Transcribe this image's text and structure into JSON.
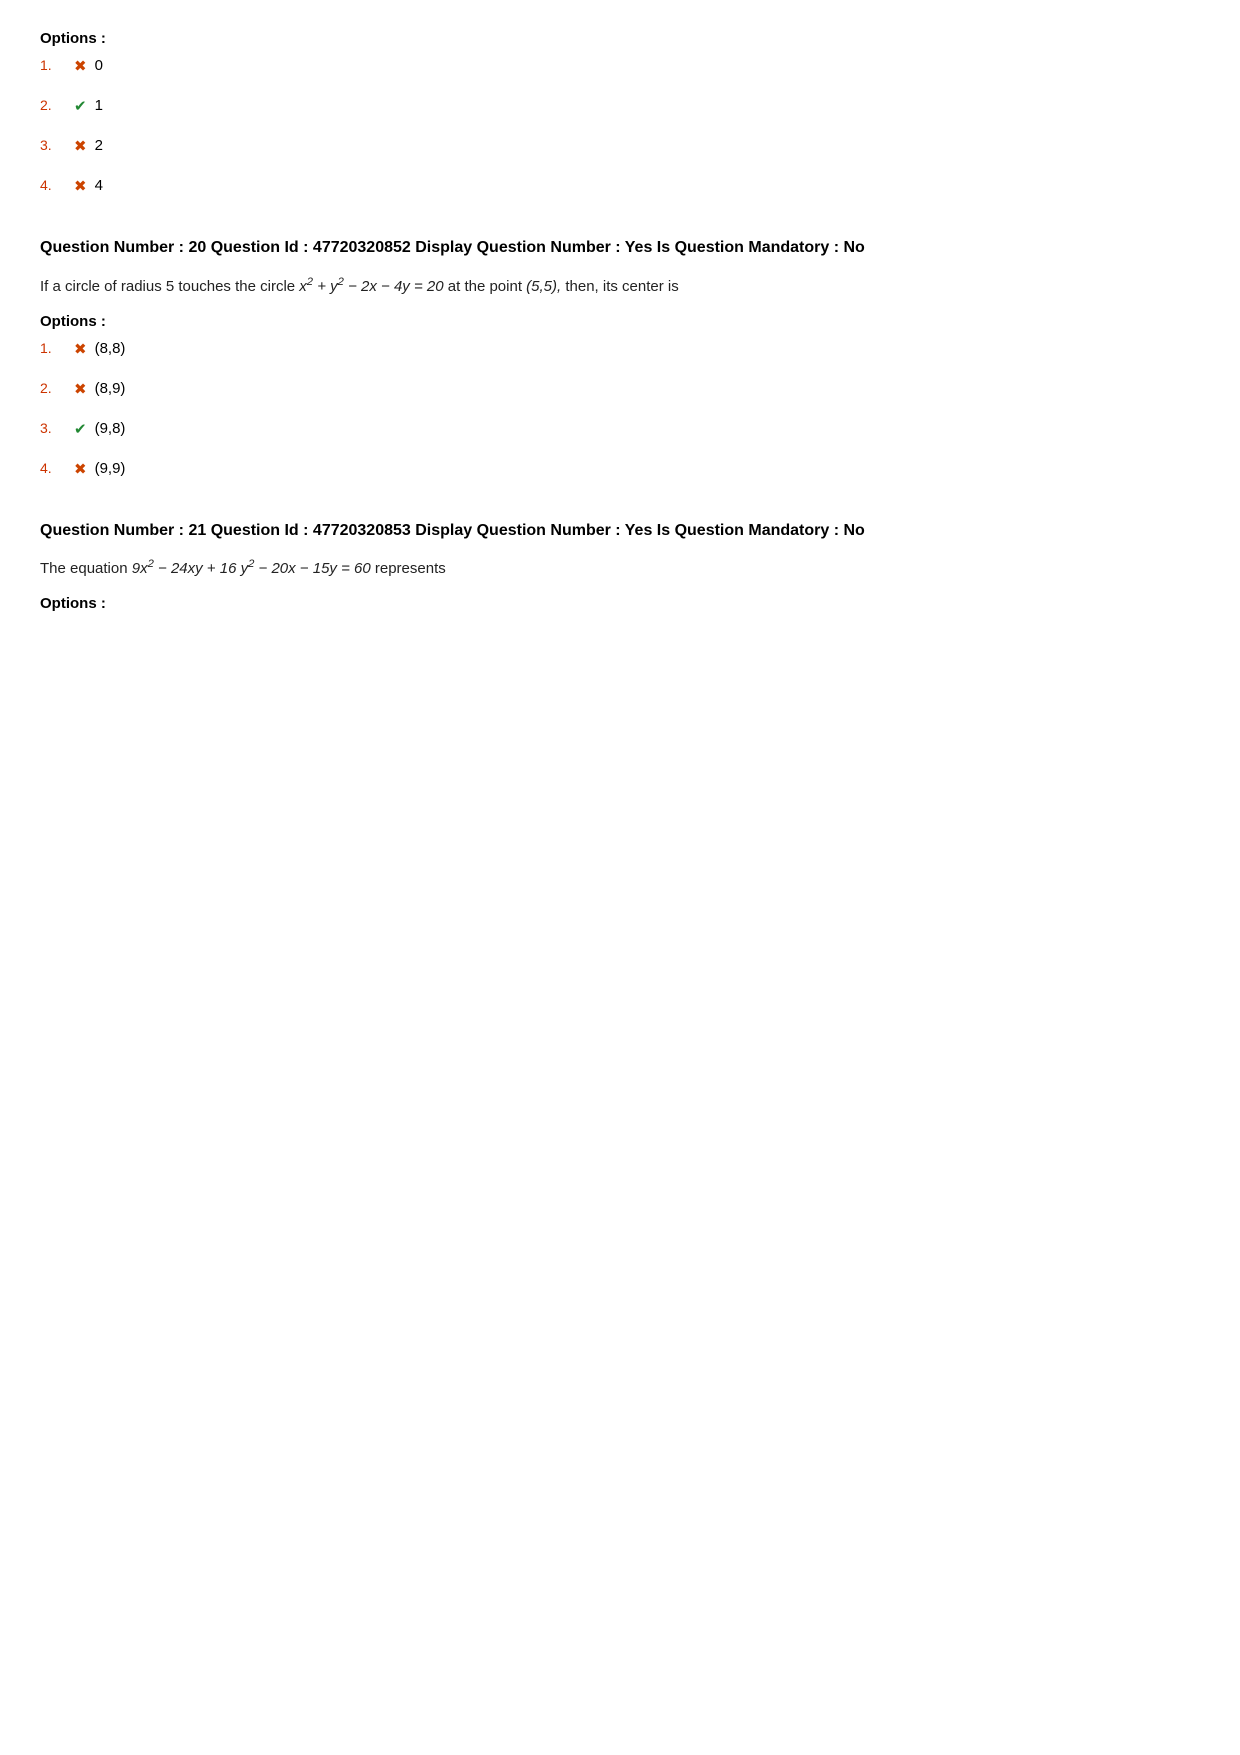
{
  "questions": [
    {
      "id": "q_top",
      "options_label": "Options :",
      "options": [
        {
          "number": "1.",
          "icon": "✖",
          "icon_type": "wrong",
          "text": "0"
        },
        {
          "number": "2.",
          "icon": "✔",
          "icon_type": "correct",
          "text": "1"
        },
        {
          "number": "3.",
          "icon": "✖",
          "icon_type": "wrong",
          "text": "2"
        },
        {
          "number": "4.",
          "icon": "✖",
          "icon_type": "wrong",
          "text": "4"
        }
      ]
    },
    {
      "id": "q20",
      "header": "Question Number : 20 Question Id : 47720320852 Display Question Number : Yes Is Question Mandatory : No",
      "question_text_plain": "If a circle of radius 5 touches the circle x² + y² − 2x − 4y = 20 at the point (5,5),  then, its center is",
      "options_label": "Options :",
      "options": [
        {
          "number": "1.",
          "icon": "✖",
          "icon_type": "wrong",
          "text": "(8,8)"
        },
        {
          "number": "2.",
          "icon": "✖",
          "icon_type": "wrong",
          "text": "(8,9)"
        },
        {
          "number": "3.",
          "icon": "✔",
          "icon_type": "correct",
          "text": "(9,8)"
        },
        {
          "number": "4.",
          "icon": "✖",
          "icon_type": "wrong",
          "text": "(9,9)"
        }
      ]
    },
    {
      "id": "q21",
      "header": "Question Number : 21 Question Id : 47720320853 Display Question Number : Yes Is Question Mandatory : No",
      "question_text_plain": "The equation 9x² − 24xy + 16 y² − 20x − 15y = 60 represents",
      "options_label": "Options :"
    }
  ]
}
